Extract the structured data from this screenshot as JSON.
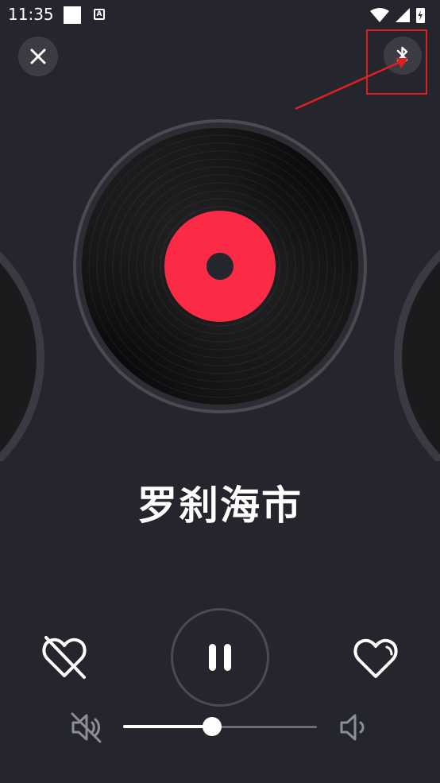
{
  "status_bar": {
    "time": "11:35",
    "a_badge": "A"
  },
  "song": {
    "title": "罗刹海市"
  },
  "volume": {
    "level": 0.46
  },
  "player": {
    "state": "playing"
  },
  "colors": {
    "background": "#24252d",
    "record_label": "#fb2b45",
    "button_bg": "#3b3c44",
    "highlight": "#e02020"
  },
  "icons": {
    "close": "close-icon",
    "bluetooth": "bluetooth-icon",
    "dislike": "broken-heart-icon",
    "pause": "pause-icon",
    "like": "heart-icon",
    "mute": "volume-mute-icon",
    "volume": "volume-icon"
  }
}
